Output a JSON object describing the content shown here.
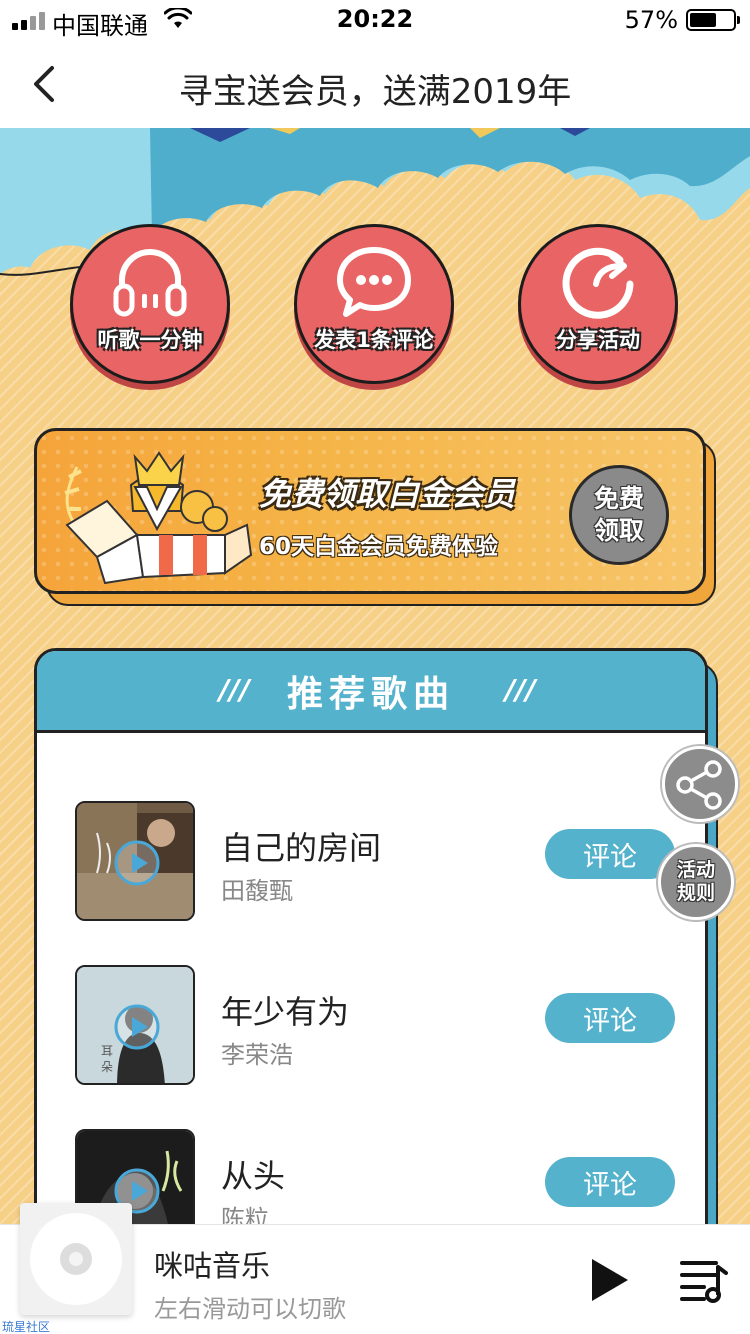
{
  "status_bar": {
    "carrier": "中国联通",
    "time": "20:22",
    "battery": "57%",
    "icons": [
      "signal-icon",
      "wifi-icon",
      "battery-icon"
    ]
  },
  "nav": {
    "title": "寻宝送会员，送满2019年",
    "back_icon": "chevron-left-icon"
  },
  "tasks": [
    {
      "label": "听歌一分钟",
      "icon": "headphones-icon"
    },
    {
      "label": "发表1条评论",
      "icon": "comment-bubble-icon"
    },
    {
      "label": "分享活动",
      "icon": "share-arrow-icon"
    }
  ],
  "promo": {
    "title": "免费领取白金会员",
    "subtitle": "60天白金会员免费体验",
    "button": "免费领取",
    "icon": "gift-box-crown-icon"
  },
  "recommend": {
    "title": "推荐歌曲",
    "songs": [
      {
        "name": "自己的房间",
        "artist": "田馥甄",
        "comment_label": "评论"
      },
      {
        "name": "年少有为",
        "artist": "李荣浩",
        "comment_label": "评论"
      },
      {
        "name": "从头",
        "artist": "陈粒",
        "comment_label": "评论"
      }
    ]
  },
  "floating": {
    "share_icon": "share-nodes-icon",
    "rules_label": "活动规则"
  },
  "player": {
    "name": "咪咕音乐",
    "subtitle": "左右滑动可以切歌",
    "icons": [
      "disc-icon",
      "play-icon",
      "playlist-icon"
    ]
  },
  "watermark": "琉星社区",
  "colors": {
    "background": "#f7d088",
    "task_red": "#e96464",
    "accent_blue": "#55b2cc",
    "promo_orange": "#f5a43a"
  }
}
